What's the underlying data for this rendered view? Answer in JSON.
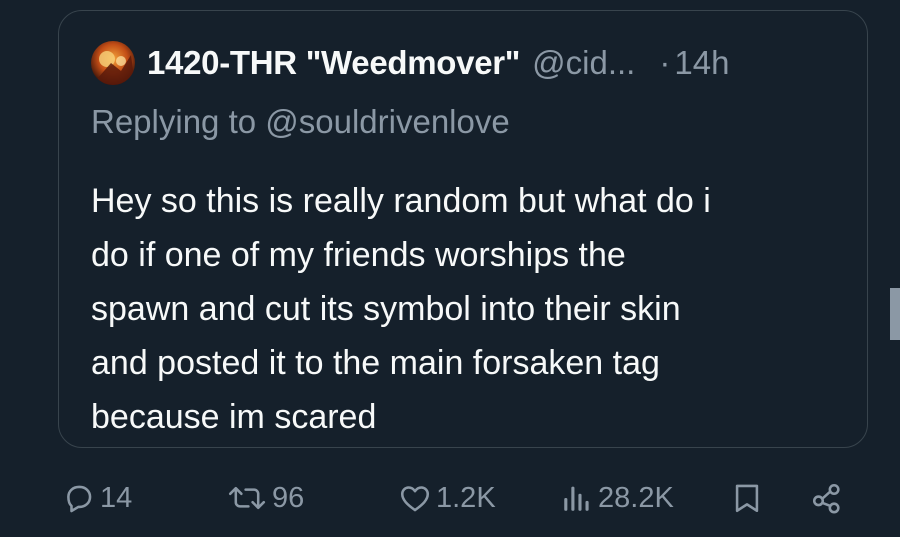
{
  "quoted_post": {
    "author_name": "1420-THR \"Weedmover\"",
    "author_handle": "@cid...",
    "dot": "·",
    "time": "14h",
    "replying_to": "Replying to @souldrivenlove",
    "text_lines": [
      "Hey so this is really random but what do i",
      "do if one of my friends worships the",
      "spawn and cut its symbol into their skin",
      "and posted it to the main forsaken tag",
      "because im scared"
    ]
  },
  "actions": {
    "replies": "14",
    "reposts": "96",
    "likes": "1.2K",
    "views": "28.2K"
  },
  "icons": {
    "reply": "reply-icon",
    "repost": "repost-icon",
    "like": "heart-icon",
    "views": "views-icon",
    "bookmark": "bookmark-icon",
    "share": "share-icon"
  },
  "colors": {
    "background": "#15202b",
    "border": "#38444d",
    "primary_text": "#f7f9f9",
    "secondary_text": "#8b98a5"
  }
}
